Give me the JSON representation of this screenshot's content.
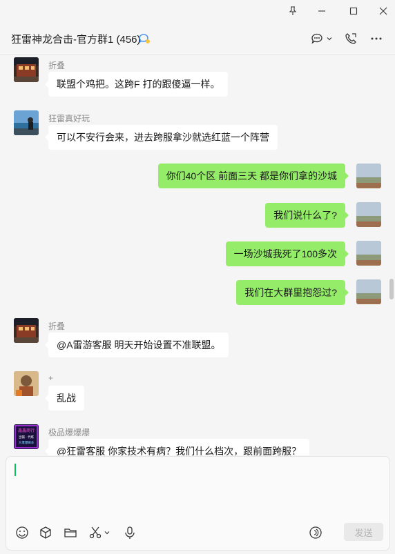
{
  "window": {
    "pin_icon": "pin-icon",
    "minimize_icon": "minimize-icon",
    "maximize_icon": "maximize-icon",
    "close_icon": "close-icon"
  },
  "header": {
    "title": "狂雷神龙合击-官方群1 (456)",
    "badge_icon": "group-chat-badge-icon",
    "icons": [
      "chat-bubble-icon",
      "chevron-down-icon",
      "voice-call-icon",
      "more-icon"
    ]
  },
  "messages": [
    {
      "side": "left",
      "sender": "折叠",
      "text": "联盟个鸡把。这跨F 打的跟傻逼一样。"
    },
    {
      "side": "left",
      "sender": "狂雷真好玩",
      "text": "可以不安行会来，进去跨服拿沙就选红蓝一个阵营"
    },
    {
      "side": "right",
      "text": "你们40个区 前面三天 都是你们拿的沙城"
    },
    {
      "side": "right",
      "text": "我们说什么了?"
    },
    {
      "side": "right",
      "text": "一场沙城我死了100多次"
    },
    {
      "side": "right",
      "text": "我们在大群里抱怨过?"
    },
    {
      "side": "left",
      "sender": "折叠",
      "text": "@A雷游客服 明天开始设置不准联盟。"
    },
    {
      "side": "left",
      "sender": "+",
      "text": "乱战"
    },
    {
      "side": "left",
      "sender": "极品爆爆爆",
      "text": "@狂雷客服   你家技术有病？我们什么档次，跟前面跨服？"
    }
  ],
  "avatar_texts": {
    "promo_line1": "鑫鑫商行",
    "promo_line2": "当铺 · 代练",
    "promo_line3": "大爆爆脚本"
  },
  "composer": {
    "tools": [
      "emoji-icon",
      "box-icon",
      "folder-icon",
      "scissors-icon",
      "microphone-icon"
    ],
    "voice_icon": "voice-input-icon",
    "send_label": "发送"
  },
  "colors": {
    "outgoing_bubble": "#95ec69",
    "incoming_bubble": "#ffffff",
    "background": "#f5f5f5",
    "caret": "#07c160"
  }
}
